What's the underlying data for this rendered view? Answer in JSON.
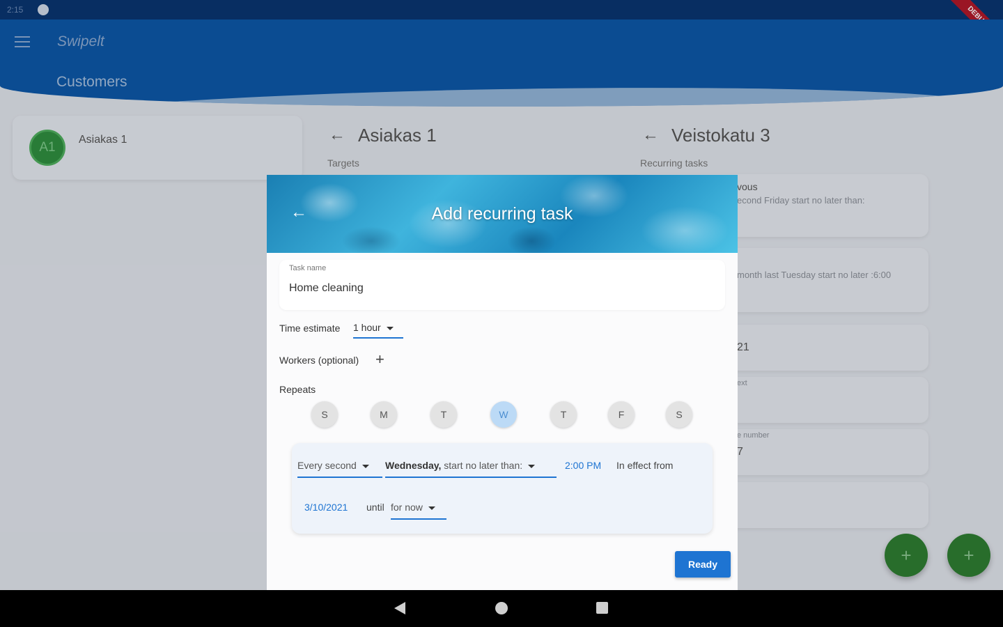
{
  "status_bar": {
    "time": "2:15"
  },
  "debug_banner": "DEBUG",
  "app_bar": {
    "title": "Swipelt",
    "section": "Customers"
  },
  "customers": [
    {
      "initials": "A1",
      "name": "Asiakas 1"
    }
  ],
  "targets_panel": {
    "title": "Asiakas 1",
    "subtitle": "Targets"
  },
  "recurring_panel": {
    "title": "Veistokatu 3",
    "subtitle": "Recurring tasks",
    "cards": [
      {
        "line1": "vous",
        "line2": "econd Friday start no later than:"
      },
      {
        "line1": "",
        "line2": "month last Tuesday start no later :6:00"
      },
      {
        "line1": "21",
        "line2": ""
      },
      {
        "line1": "",
        "line2": "ext"
      },
      {
        "line1": "7",
        "line2": "e number"
      },
      {
        "line1": "",
        "line2": ""
      }
    ]
  },
  "dialog": {
    "title": "Add recurring task",
    "task_name_label": "Task name",
    "task_name_value": "Home cleaning",
    "time_estimate_label": "Time estimate",
    "time_estimate_value": "1 hour",
    "workers_label": "Workers (optional)",
    "repeats_label": "Repeats",
    "days": [
      {
        "label": "S",
        "selected": false
      },
      {
        "label": "M",
        "selected": false
      },
      {
        "label": "T",
        "selected": false
      },
      {
        "label": "W",
        "selected": true
      },
      {
        "label": "T",
        "selected": false
      },
      {
        "label": "F",
        "selected": false
      },
      {
        "label": "S",
        "selected": false
      }
    ],
    "repeat_rule": {
      "frequency": "Every second",
      "day": "Wednesday,",
      "start_text": "start no later than:",
      "time": "2:00 PM",
      "effect_label": "In effect from",
      "start_date": "3/10/2021",
      "until_label": "until",
      "until_value": "for now"
    },
    "ready_label": "Ready"
  },
  "fabs": [
    "+",
    "+"
  ],
  "colors": {
    "primary": "#1e74d2",
    "app_bar": "#0d57a7",
    "fab": "#2e7d32"
  }
}
